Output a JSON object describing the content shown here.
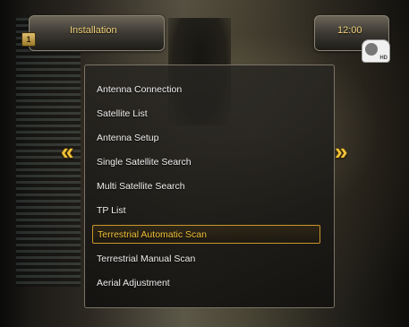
{
  "header": {
    "title": "Installation",
    "clock": "12:00",
    "badge_label": "HD"
  },
  "colors": {
    "accent": "#f2c23a",
    "text": "#f0f0f0",
    "title_text": "#f2d27a",
    "selection_border": "#c9962a"
  },
  "icons": {
    "left_arrow": "double-chevron-left-icon",
    "right_arrow": "double-chevron-right-icon",
    "corner": "menu-corner-icon",
    "channel_badge": "hd-badge-icon"
  },
  "menu": {
    "items": [
      {
        "label": "Antenna Connection",
        "selected": false
      },
      {
        "label": "Satellite List",
        "selected": false
      },
      {
        "label": "Antenna Setup",
        "selected": false
      },
      {
        "label": "Single Satellite Search",
        "selected": false
      },
      {
        "label": "Multi Satellite Search",
        "selected": false
      },
      {
        "label": "TP List",
        "selected": false
      },
      {
        "label": "Terrestrial Automatic Scan",
        "selected": true
      },
      {
        "label": "Terrestrial Manual Scan",
        "selected": false
      },
      {
        "label": "Aerial Adjustment",
        "selected": false
      }
    ]
  }
}
